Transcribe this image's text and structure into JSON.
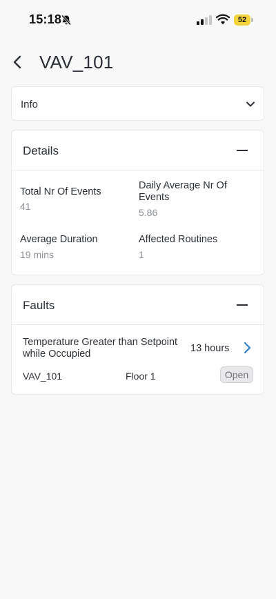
{
  "status_bar": {
    "time": "15:18",
    "battery": "52",
    "icons": [
      "bell-slash-icon",
      "signal-icon",
      "wifi-icon",
      "battery-icon"
    ],
    "battery_color": "#f5d33b"
  },
  "header": {
    "title": "VAV_101",
    "back_icon": "chevron-left-icon"
  },
  "info": {
    "label": "Info",
    "expand_icon": "chevron-down-icon"
  },
  "details": {
    "title": "Details",
    "collapse_icon": "minus-icon",
    "stats": [
      {
        "label": "Total Nr Of Events",
        "value": "41"
      },
      {
        "label": "Daily Average Nr Of Events",
        "value": "5.86"
      },
      {
        "label": "Average Duration",
        "value": "19 mins"
      },
      {
        "label": "Affected Routines",
        "value": "1"
      }
    ]
  },
  "faults": {
    "title": "Faults",
    "collapse_icon": "minus-icon",
    "items": [
      {
        "title": "Temperature Greater than Setpoint while Occupied",
        "duration": "13 hours",
        "device": "VAV_101",
        "floor": "Floor 1",
        "status": "Open"
      }
    ]
  },
  "colors": {
    "background": "#f8f8f9",
    "card": "#ffffff",
    "text": "#2b2f38",
    "muted": "#8a8e96",
    "accent": "#2f80c9"
  }
}
